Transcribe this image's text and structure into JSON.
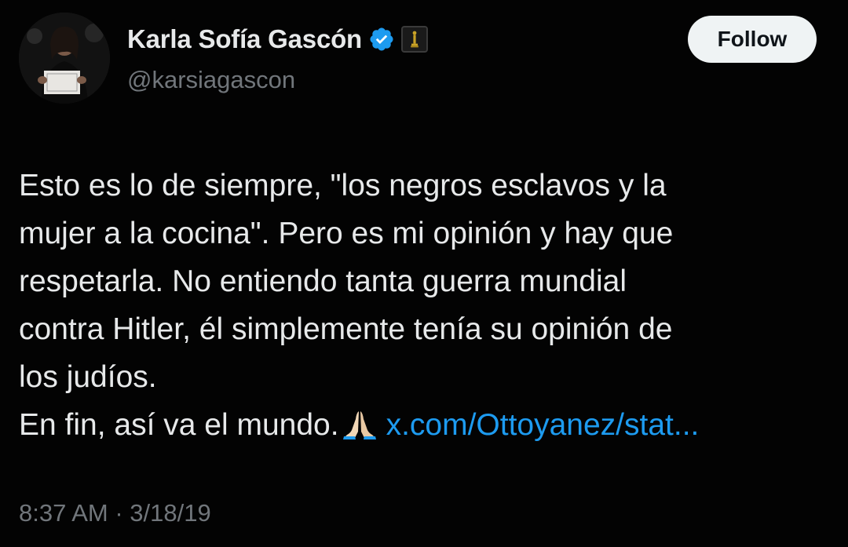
{
  "tweet": {
    "author": {
      "display_name": "Karla Sofía Gascón",
      "handle": "@karsiagascon",
      "verified_icon": "verified-badge-icon",
      "affiliate_icon": "oscar-statuette-icon"
    },
    "follow_label": "Follow",
    "lines": [
      "Esto es lo de siempre, \"los negros esclavos y la",
      "mujer a la cocina\". Pero es mi opinión y hay que",
      "respetarla. No entiendo tanta guerra mundial",
      "contra Hitler, él simplemente tenía su opinión de",
      "los judíos."
    ],
    "last_line_text": "En fin, así va el mundo.",
    "emoji": "folded-hands-emoji",
    "link_text": "x.com/Ottoyanez/stat...",
    "timestamp": "8:37 AM · 3/18/19"
  },
  "colors": {
    "background": "#030303",
    "text": "#e7e9ea",
    "secondary": "#71767b",
    "link": "#1d9bf0",
    "verified": "#1d9bf0",
    "button_bg": "#eff3f4"
  }
}
